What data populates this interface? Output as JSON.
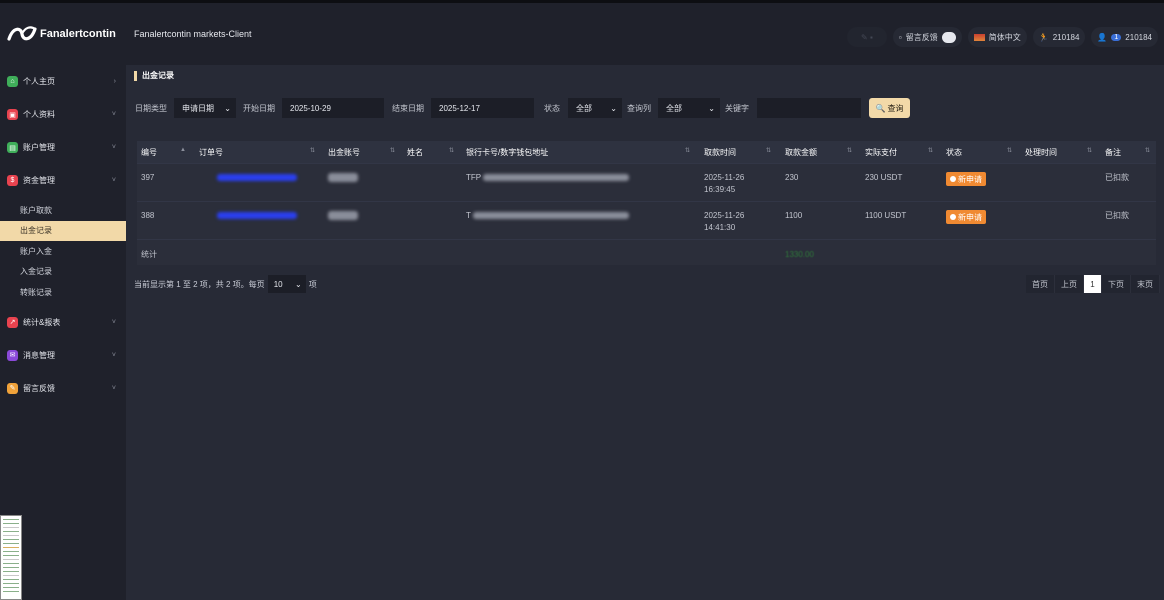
{
  "header": {
    "brand": "Fanalertcontin",
    "app_title": "Fanalertcontin markets-Client",
    "feedback_label": "留言反馈",
    "language_label": "简体中文",
    "user_id": "210184",
    "account_id": "210184",
    "notification_count": "1"
  },
  "sidebar": {
    "items": [
      {
        "label": "个人主页",
        "icon": "home-icon",
        "color": "#3fae5a"
      },
      {
        "label": "个人资料",
        "icon": "profile-icon",
        "color": "#e8434f"
      },
      {
        "label": "账户管理",
        "icon": "account-icon",
        "color": "#3fae5a"
      },
      {
        "label": "资金管理",
        "icon": "dollar-icon",
        "color": "#e8434f"
      },
      {
        "label": "统计&报表",
        "icon": "chart-icon",
        "color": "#e8434f"
      },
      {
        "label": "消息管理",
        "icon": "message-icon",
        "color": "#8a49d8"
      },
      {
        "label": "留言反馈",
        "icon": "feedback-icon",
        "color": "#f0a23a"
      }
    ],
    "subitems": [
      "账户取款",
      "出金记录",
      "账户入金",
      "入金记录",
      "转账记录"
    ],
    "active_sub": "出金记录"
  },
  "page": {
    "section_title": "出金记录"
  },
  "filters": {
    "date_type_label": "日期类型",
    "date_type_value": "申请日期",
    "start_label": "开始日期",
    "start_value": "2025-10-29",
    "end_label": "结束日期",
    "end_value": "2025-12-17",
    "status_label": "状态",
    "status_value": "全部",
    "query_col_label": "查询列",
    "query_col_value": "全部",
    "keyword_label": "关键字",
    "keyword_value": "",
    "search_button": "查询"
  },
  "table": {
    "columns": [
      "编号",
      "订单号",
      "出金账号",
      "姓名",
      "银行卡号/数字钱包地址",
      "取款时间",
      "取款金额",
      "实际支付",
      "状态",
      "处理时间",
      "备注"
    ],
    "rows": [
      {
        "id": "397",
        "bank_prefix": "TFP",
        "time_date": "2025-11-26",
        "time_clock": "16:39:45",
        "amount": "230",
        "actual": "230 USDT",
        "status": "新申请",
        "processed": "",
        "remark": "已扣款"
      },
      {
        "id": "388",
        "bank_prefix": "T",
        "time_date": "2025-11-26",
        "time_clock": "14:41:30",
        "amount": "1100",
        "actual": "1100 USDT",
        "status": "新申请",
        "processed": "",
        "remark": "已扣款"
      }
    ],
    "summary_label": "统计",
    "summary_total": "1330.00"
  },
  "pagination": {
    "info_prefix": "当前显示第 1 至 2 项，共 2 项。每页",
    "page_size": "10",
    "info_suffix": "项",
    "first": "首页",
    "prev": "上页",
    "current": "1",
    "next": "下页",
    "last": "末页"
  },
  "colors": {
    "accent": "#f2d9a8",
    "status_badge": "#f08a32",
    "order_link": "#2a3ff0"
  }
}
